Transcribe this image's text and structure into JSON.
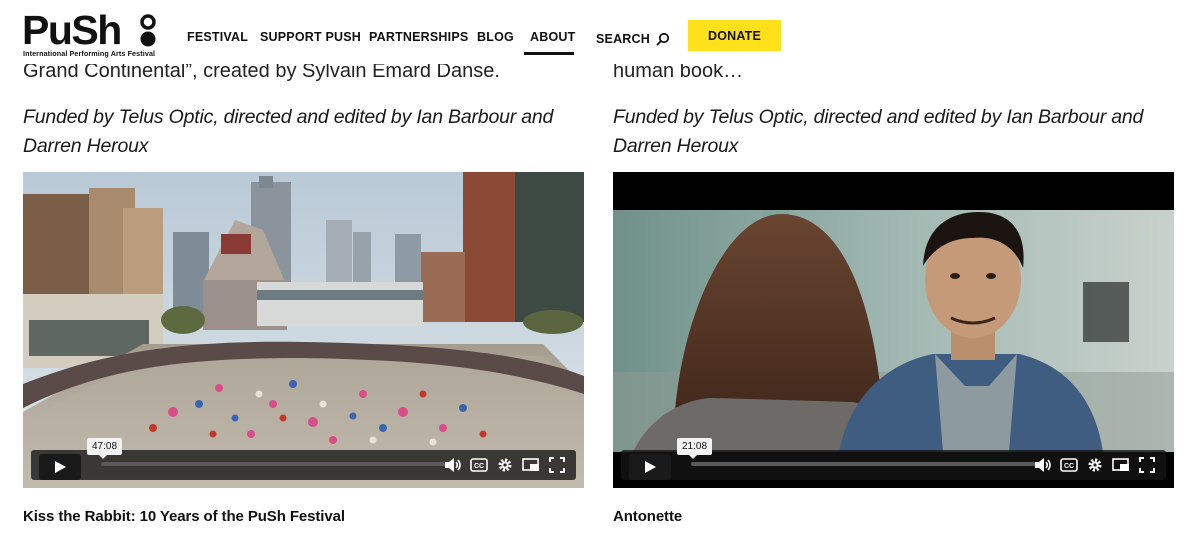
{
  "brand": {
    "logo_text": "PuSh",
    "tagline": "International Performing Arts Festival"
  },
  "nav": {
    "festival": "FESTIVAL",
    "support": "SUPPORT PUSH",
    "partnerships": "PARTNERSHIPS",
    "blog": "BLOG",
    "about": "ABOUT",
    "search": "SEARCH",
    "donate": "DONATE",
    "active": "ABOUT"
  },
  "colors": {
    "donate_bg": "#ffe01b",
    "text": "#111111",
    "player_bar": "#141414"
  },
  "videos": [
    {
      "prev_text": "Grand Continental”, created by Sylvain Émard Danse.",
      "credits": "Funded by Telus Optic, directed and edited by Ian Barbour and Darren Heroux",
      "duration": "47:08",
      "title": "Kiss the Rabbit: 10 Years of the PuSh Festival"
    },
    {
      "prev_text": "human book…",
      "credits": "Funded by Telus Optic, directed and edited by Ian Barbour and Darren Heroux",
      "duration": "21:08",
      "title": "Antonette"
    }
  ],
  "player_controls": [
    "play-icon",
    "volume-icon",
    "captions-icon",
    "settings-icon",
    "picture-in-picture-icon",
    "fullscreen-icon"
  ]
}
